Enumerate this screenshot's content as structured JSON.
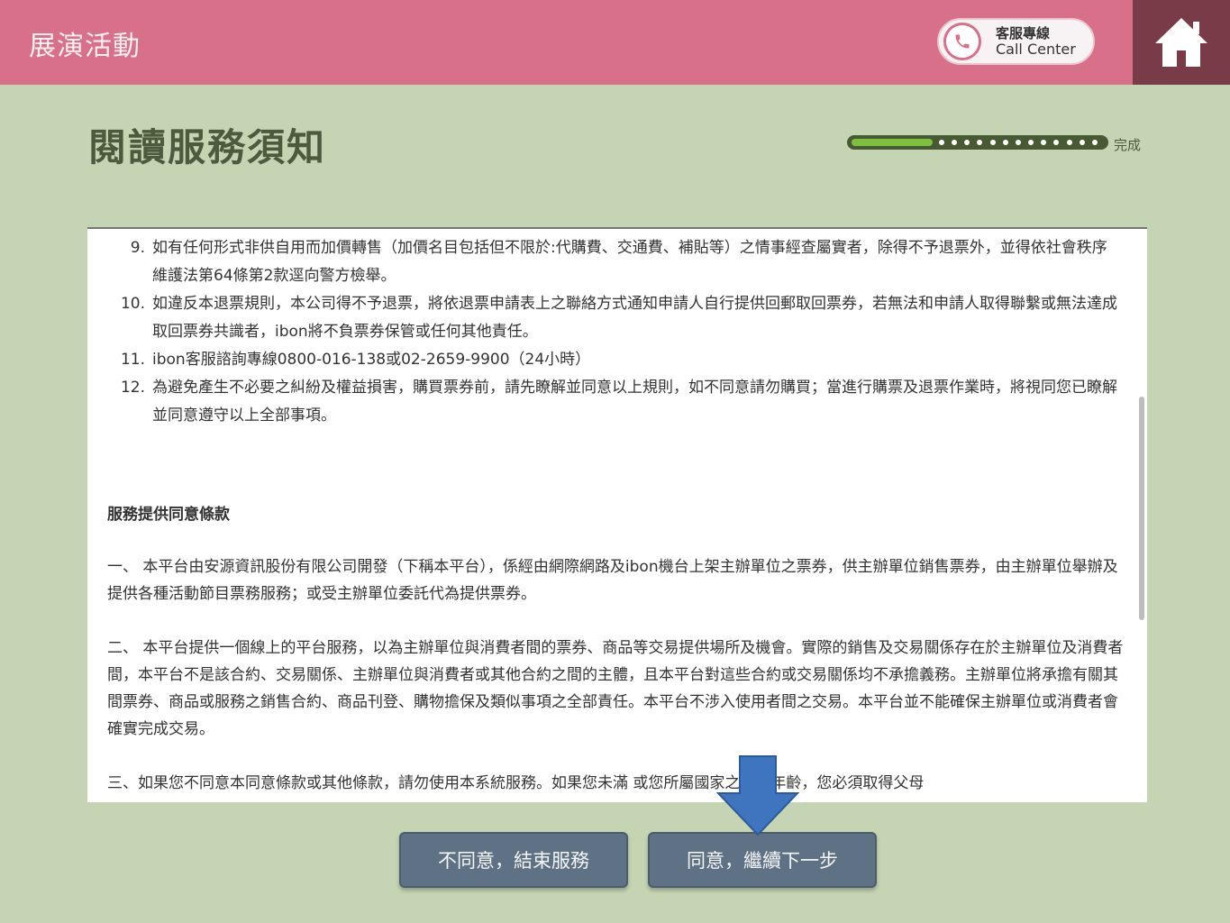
{
  "header": {
    "title": "展演活動",
    "call_center_zh": "客服專線",
    "call_center_en": "Call Center"
  },
  "page": {
    "title": "閱讀服務須知",
    "progress_label": "完成",
    "progress_fraction": 0.32
  },
  "rules": [
    {
      "num": "9.",
      "text": "如有任何形式非供自用而加價轉售（加價名目包括但不限於:代購費、交通費、補貼等）之情事經查屬實者，除得不予退票外，並得依社會秩序維護法第64條第2款逕向警方檢舉。"
    },
    {
      "num": "10.",
      "text": "如違反本退票規則，本公司得不予退票，將依退票申請表上之聯絡方式通知申請人自行提供回郵取回票券，若無法和申請人取得聯繫或無法達成取回票券共識者，ibon將不負票券保管或任何其他責任。"
    },
    {
      "num": "11.",
      "text": "ibon客服諮詢專線0800-016-138或02-2659-9900（24小時）"
    },
    {
      "num": "12.",
      "text": "為避免產生不必要之糾紛及權益損害，購買票券前，請先瞭解並同意以上規則，如不同意請勿購買；當進行購票及退票作業時，將視同您已瞭解並同意遵守以上全部事項。"
    }
  ],
  "terms": {
    "title": "服務提供同意條款",
    "p1": "一、 本平台由安源資訊股份有限公司開發（下稱本平台），係經由網際網路及ibon機台上架主辦單位之票券，供主辦單位銷售票券，由主辦單位舉辦及提供各種活動節目票務服務；或受主辦單位委託代為提供票券。",
    "p2": "二、 本平台提供一個線上的平台服務，以為主辦單位與消費者間的票券、商品等交易提供場所及機會。實際的銷售及交易關係存在於主辦單位及消費者間，本平台不是該合約、交易關係、主辦單位與消費者或其他合約之間的主體，且本平台對這些合約或交易關係均不承擔義務。主辦單位將承擔有關其間票券、商品或服務之銷售合約、商品刊登、購物擔保及類似事項之全部責任。本平台不涉入使用者間之交易。本平台並不能確保主辦單位或消費者會確實完成交易。",
    "p3": "三、如果您不同意本同意條款或其他條款，請勿使用本系統服務。如果您未滿 或您所屬國家之法定年齡，您必須取得父母"
  },
  "buttons": {
    "disagree": "不同意，結束服務",
    "agree": "同意，繼續下一步"
  },
  "colors": {
    "header": "#d97089",
    "home": "#7a3b48",
    "background": "#c5d4b2",
    "button": "#5f7185",
    "arrow": "#3f74be"
  }
}
